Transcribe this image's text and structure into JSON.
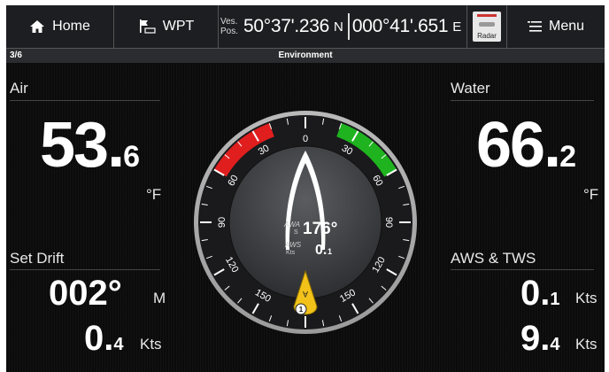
{
  "topbar": {
    "home_label": "Home",
    "wpt_label": "WPT",
    "ves_pos_label_1": "Ves.",
    "ves_pos_label_2": "Pos.",
    "latitude": "50°37'.236",
    "lat_hemi": "N",
    "longitude": "000°41'.651",
    "lon_hemi": "E",
    "radar_label": "Radar",
    "menu_label": "Menu"
  },
  "titlebar": {
    "page": "3/6",
    "title": "Environment"
  },
  "air": {
    "label": "Air",
    "value_int": "53.",
    "value_dec": "6",
    "unit": "°F"
  },
  "water": {
    "label": "Water",
    "value_int": "66.",
    "value_dec": "2",
    "unit": "°F"
  },
  "set_drift": {
    "label": "Set Drift",
    "set_value": "002°",
    "set_unit": "M",
    "drift_int": "0.",
    "drift_dec": "4",
    "drift_unit": "Kts"
  },
  "aws_tws": {
    "label": "AWS & TWS",
    "aws_int": "0.",
    "aws_dec": "1",
    "aws_unit": "Kts",
    "tws_int": "9.",
    "tws_dec": "4",
    "tws_unit": "Kts"
  },
  "gauge": {
    "scale_labels": [
      "0",
      "30",
      "60",
      "90",
      "120",
      "150",
      "150",
      "120",
      "90",
      "60",
      "30"
    ],
    "awa_label_1": "AWA",
    "awa_label_2": "S",
    "awa_value": "176°",
    "aws_label_1": "AWS",
    "aws_label_2": "Kts",
    "aws_int": "0.",
    "aws_dec": "1",
    "pointer_letter": "A",
    "pointer_badge": "1",
    "colors": {
      "port": "#e01e1e",
      "starboard": "#1fb31f",
      "pointer": "#f2c21a"
    }
  }
}
